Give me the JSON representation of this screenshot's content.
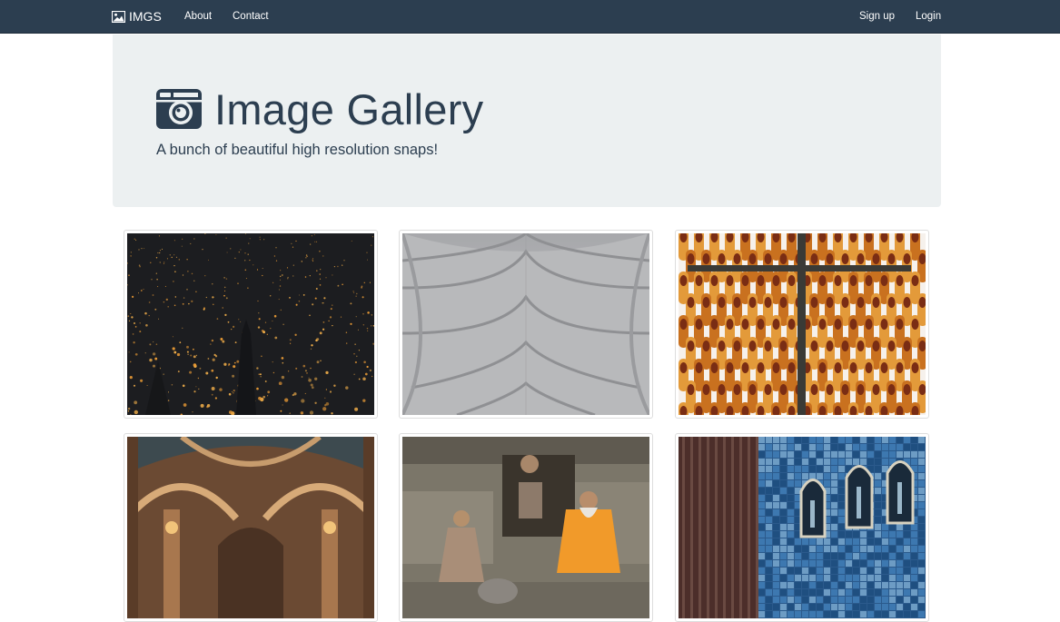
{
  "navbar": {
    "brand": "IMGS",
    "links": {
      "about": "About",
      "contact": "Contact",
      "signup": "Sign up",
      "login": "Login"
    },
    "background_color": "#2c3e50"
  },
  "jumbotron": {
    "title": "Image Gallery",
    "subtitle": "A bunch of beautiful high resolution snaps!",
    "icon": "camera-icon",
    "background_color": "#ecf0f1"
  },
  "gallery": {
    "images": [
      {
        "name": "floating-lanterns-photo"
      },
      {
        "name": "gothic-arch-ceiling-photo"
      },
      {
        "name": "amber-cross-installation-photo"
      },
      {
        "name": "cathedral-interior-photo"
      },
      {
        "name": "sadhus-temple-photo"
      },
      {
        "name": "blue-tiled-facade-photo"
      }
    ]
  }
}
